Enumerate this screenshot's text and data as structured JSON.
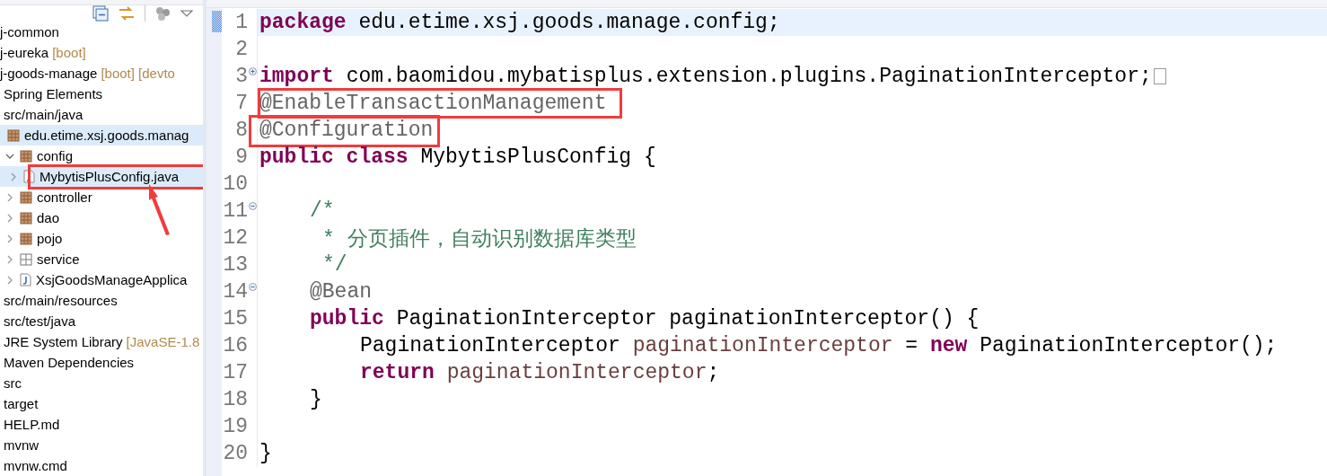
{
  "explorer": {
    "tree": [
      {
        "label": "j-common",
        "selected": false
      },
      {
        "label": "j-eureka",
        "decoration": "[boot]",
        "selected": false
      },
      {
        "label": "j-goods-manage",
        "decoration": "[boot] [devto",
        "selected": false,
        "children": [
          {
            "label": "Spring Elements",
            "selected": false
          },
          {
            "label": "src/main/java",
            "selected": false,
            "children": [
              {
                "label": "edu.etime.xsj.goods.manag",
                "kind": "package",
                "selected": true,
                "children": [
                  {
                    "label": "config",
                    "kind": "package",
                    "expanded": true,
                    "selected": false,
                    "children": [
                      {
                        "label": "MybytisPlusConfig.java",
                        "kind": "java",
                        "expanded": false,
                        "selected": true,
                        "boxed": true
                      }
                    ]
                  },
                  {
                    "label": "controller",
                    "kind": "package",
                    "expanded": false,
                    "selected": false
                  },
                  {
                    "label": "dao",
                    "kind": "package",
                    "expanded": false,
                    "selected": false
                  },
                  {
                    "label": "pojo",
                    "kind": "package",
                    "expanded": false,
                    "selected": false
                  },
                  {
                    "label": "service",
                    "kind": "empty-package",
                    "expanded": false,
                    "selected": false
                  },
                  {
                    "label": "XsjGoodsManageApplica",
                    "kind": "java",
                    "expanded": false,
                    "selected": false
                  }
                ]
              }
            ]
          },
          {
            "label": "src/main/resources",
            "selected": false
          },
          {
            "label": "src/test/java",
            "selected": false
          },
          {
            "label": "JRE System Library",
            "decoration": "[JavaSE-1.8",
            "selected": false
          },
          {
            "label": "Maven Dependencies",
            "selected": false
          },
          {
            "label": "src",
            "selected": false
          },
          {
            "label": "target",
            "selected": false
          },
          {
            "label": "HELP.md",
            "selected": false
          },
          {
            "label": "mvnw",
            "selected": false
          },
          {
            "label": "mvnw.cmd",
            "selected": false
          }
        ]
      }
    ]
  },
  "editor": {
    "lines": [
      {
        "number": "1",
        "current": true,
        "kind": "top",
        "tokens": [
          {
            "kind": "keyword",
            "text": "package"
          },
          {
            "kind": "plain",
            "text": " edu.etime.xsj.goods.manage.config;"
          }
        ]
      },
      {
        "number": "2",
        "current": false,
        "kind": "top"
      },
      {
        "number": "3",
        "current": false,
        "kind": "top",
        "folded": true,
        "tokens": [
          {
            "kind": "keyword",
            "text": "import"
          },
          {
            "kind": "plain",
            "text": " com.baomidou.mybatisplus.extension.plugins.PaginationInterceptor;"
          }
        ]
      },
      {
        "number": "7",
        "current": false,
        "kind": "top",
        "boxed": true,
        "tokens": [
          {
            "kind": "annotation",
            "text": "@EnableTransactionManagement"
          }
        ]
      },
      {
        "number": "8",
        "current": false,
        "kind": "top",
        "boxed": true,
        "tokens": [
          {
            "kind": "annotation",
            "text": "@Configuration"
          }
        ]
      },
      {
        "number": "9",
        "current": false,
        "kind": "top",
        "tokens": [
          {
            "kind": "keyword",
            "text": "public class"
          },
          {
            "kind": "plain",
            "text": " MybytisPlusConfig {"
          }
        ]
      },
      {
        "number": "10",
        "current": false,
        "kind": "top"
      },
      {
        "number": "11",
        "current": false,
        "kind": "member",
        "folded": false,
        "tokens": [
          {
            "kind": "comment",
            "text": "/*"
          }
        ]
      },
      {
        "number": "12",
        "current": false,
        "kind": "doc",
        "tokens": [
          {
            "kind": "comment",
            "text": "* 分页插件，自动识别数据库类型"
          }
        ]
      },
      {
        "number": "13",
        "current": false,
        "kind": "doc",
        "tokens": [
          {
            "kind": "comment",
            "text": "*/"
          }
        ]
      },
      {
        "number": "14",
        "current": false,
        "kind": "member",
        "folded": false,
        "tokens": [
          {
            "kind": "annotation",
            "text": "@Bean"
          }
        ]
      },
      {
        "number": "15",
        "current": false,
        "kind": "member",
        "tokens": [
          {
            "kind": "keyword",
            "text": "public"
          },
          {
            "kind": "plain",
            "text": " PaginationInterceptor paginationInterceptor() {"
          }
        ]
      },
      {
        "number": "16",
        "current": false,
        "kind": "body",
        "tokens": [
          {
            "kind": "plain",
            "text": "PaginationInterceptor "
          },
          {
            "kind": "variable",
            "text": "paginationInterceptor"
          },
          {
            "kind": "plain",
            "text": " = "
          },
          {
            "kind": "keyword",
            "text": "new"
          },
          {
            "kind": "plain",
            "text": " PaginationInterceptor();"
          }
        ]
      },
      {
        "number": "17",
        "current": false,
        "kind": "body",
        "tokens": [
          {
            "kind": "keyword",
            "text": "return "
          },
          {
            "kind": "variable",
            "text": "paginationInterceptor"
          },
          {
            "kind": "plain",
            "text": ";"
          }
        ]
      },
      {
        "number": "18",
        "current": false,
        "kind": "member",
        "tokens": [
          {
            "kind": "plain",
            "text": "}"
          }
        ]
      },
      {
        "number": "19",
        "current": false,
        "kind": "top"
      },
      {
        "number": "20",
        "current": false,
        "kind": "top",
        "tokens": [
          {
            "kind": "plain",
            "text": "}"
          }
        ]
      }
    ]
  }
}
